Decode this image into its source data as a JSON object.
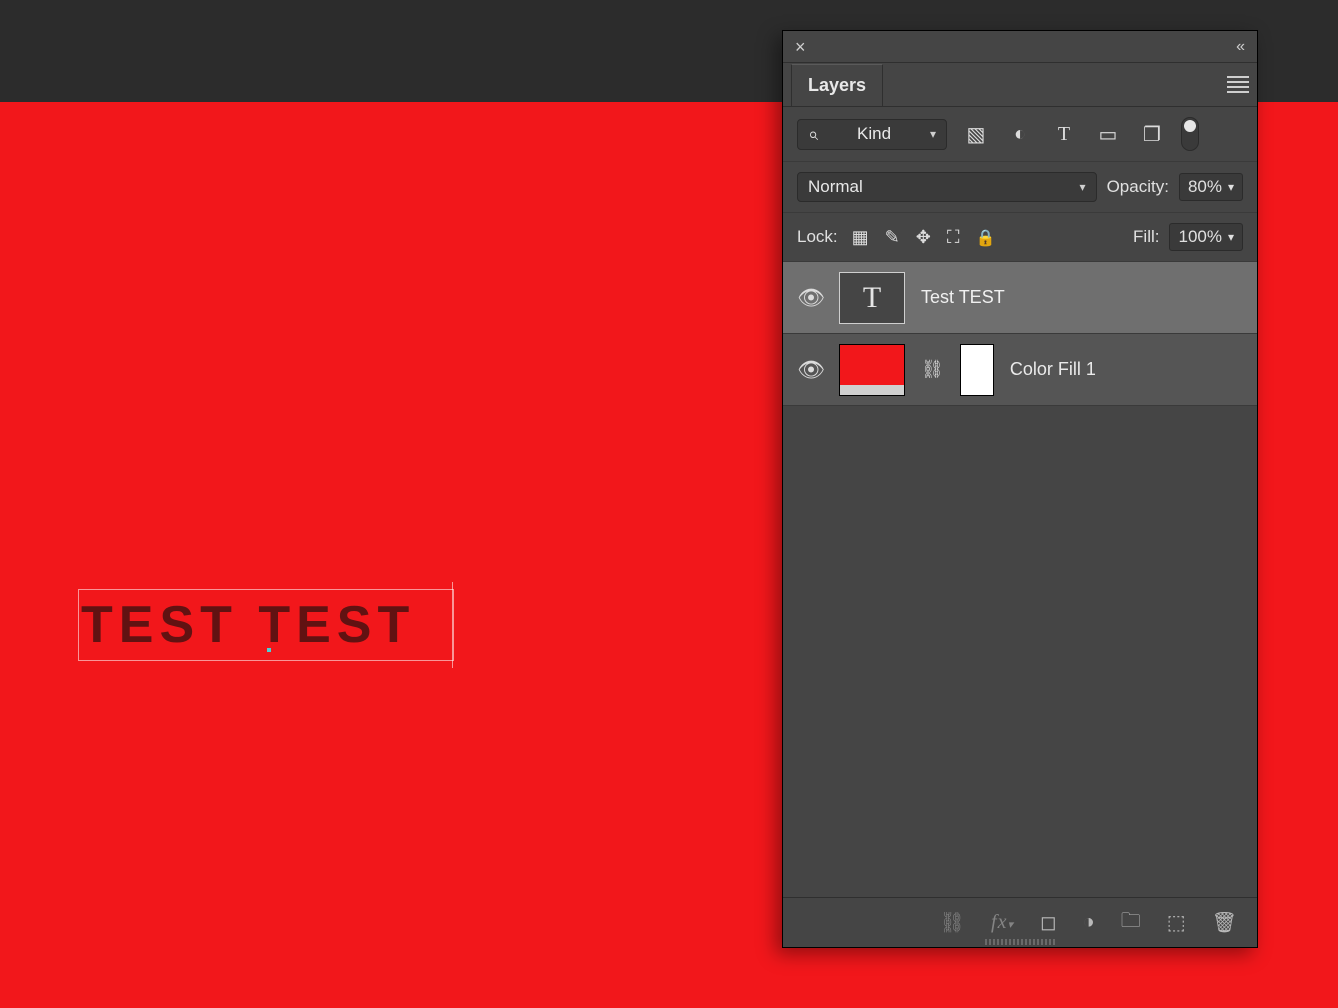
{
  "canvas": {
    "background_color": "#f2171b",
    "text_layer_content": "TEST TEST"
  },
  "panel": {
    "tab_label": "Layers",
    "filter": {
      "kind_label": "Kind"
    },
    "blend": {
      "mode": "Normal",
      "opacity_label": "Opacity:",
      "opacity_value": "80%"
    },
    "lock": {
      "label": "Lock:",
      "fill_label": "Fill:",
      "fill_value": "100%"
    },
    "layers": [
      {
        "name": "Test TEST",
        "type": "text",
        "visible": true,
        "selected": true
      },
      {
        "name": "Color Fill 1",
        "type": "fill",
        "visible": true,
        "selected": false
      }
    ]
  }
}
